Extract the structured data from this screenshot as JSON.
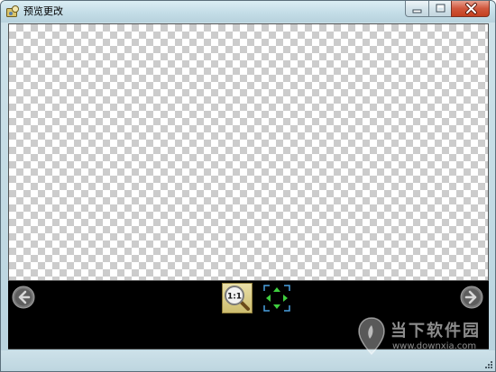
{
  "window": {
    "title": "预览更改"
  },
  "toolbar": {
    "actual_size_label": "1:1",
    "prev_icon": "arrow-left-circle-icon",
    "next_icon": "arrow-right-circle-icon",
    "fit_icon": "fit-to-window-icon"
  },
  "watermark": {
    "title": "当下软件园",
    "url": "www.downxia.com"
  },
  "colors": {
    "toolbar_bg": "#000000",
    "checker_dark": "#cccccc",
    "checker_light": "#ffffff",
    "close_button": "#c4401f",
    "fit_arrows": "#3fcf3f"
  }
}
